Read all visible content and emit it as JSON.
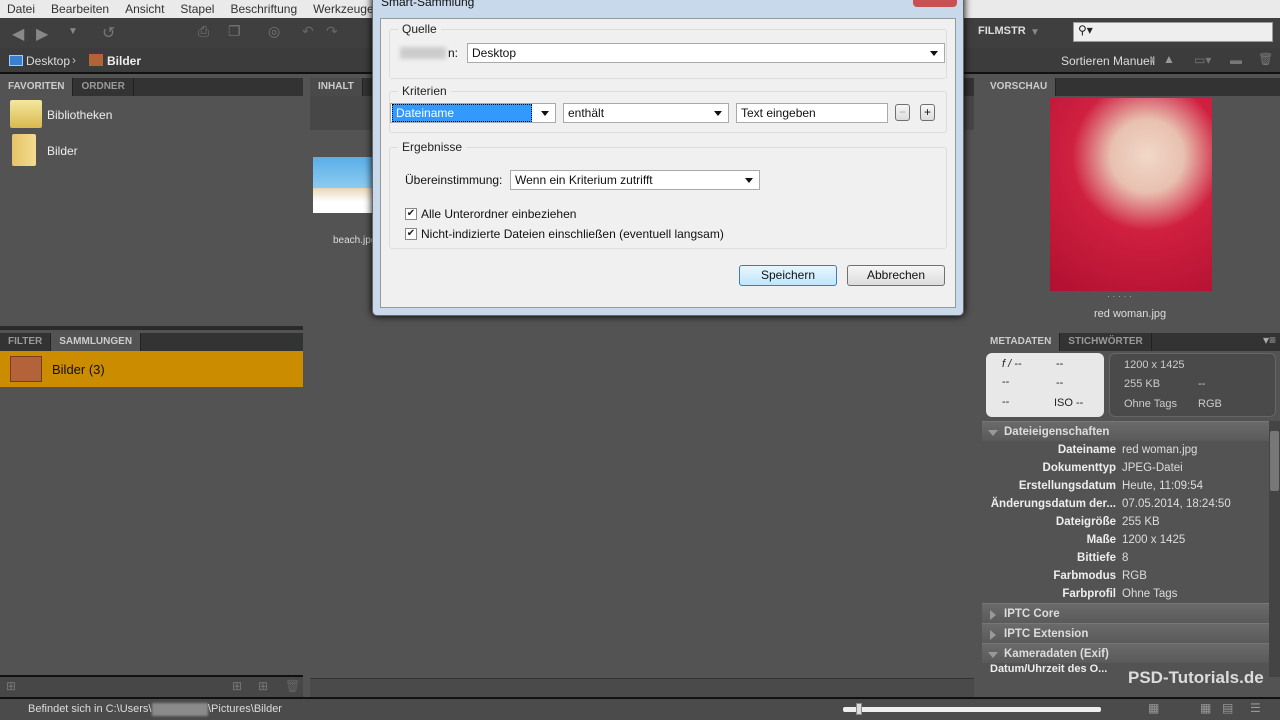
{
  "menu": [
    "Datei",
    "Bearbeiten",
    "Ansicht",
    "Stapel",
    "Beschriftung",
    "Werkzeuge"
  ],
  "breadcrumb": {
    "root": "Desktop",
    "current": "Bilder"
  },
  "workspace": "FILMSTR",
  "search_placeholder": "",
  "sort_label": "Sortieren Manuell",
  "left_tabs": [
    "FAVORITEN",
    "ORDNER"
  ],
  "favorites": [
    {
      "label": "Bibliotheken",
      "icon": "libraries-icon"
    },
    {
      "label": "Bilder",
      "icon": "folder-icon"
    }
  ],
  "lower_tabs": [
    "FILTER",
    "SAMMLUNGEN"
  ],
  "collection": {
    "label": "Bilder (3)",
    "color": "#cc8c00"
  },
  "content_tab": "INHALT",
  "thumb": {
    "label": "beach.jpg"
  },
  "preview_tab": "VORSCHAU",
  "preview_caption": "red woman.jpg",
  "meta_tabs": [
    "METADATEN",
    "STICHWÖRTER"
  ],
  "camera": {
    "aperture": "f / --",
    "shutter": "--",
    "c1": "--",
    "c2": "--",
    "c3": "--",
    "iso": "ISO --"
  },
  "fileinfo": {
    "dims": "1200 x 1425",
    "size": "255 KB",
    "x": "--",
    "tags": "Ohne Tags",
    "mode": "RGB"
  },
  "sections": {
    "file": "Dateieigenschaften",
    "iptc": "IPTC Core",
    "iptcx": "IPTC Extension",
    "exif": "Kameradaten (Exif)",
    "exif_first": "Datum/Uhrzeit des O..."
  },
  "props": [
    {
      "k": "Dateiname",
      "v": "red woman.jpg"
    },
    {
      "k": "Dokumenttyp",
      "v": "JPEG-Datei"
    },
    {
      "k": "Erstellungsdatum",
      "v": "Heute, 11:09:54"
    },
    {
      "k": "Änderungsdatum der...",
      "v": "07.05.2014, 18:24:50"
    },
    {
      "k": "Dateigröße",
      "v": "255 KB"
    },
    {
      "k": "Maße",
      "v": "1200 x 1425"
    },
    {
      "k": "Bittiefe",
      "v": "8"
    },
    {
      "k": "Farbmodus",
      "v": "RGB"
    },
    {
      "k": "Farbprofil",
      "v": "Ohne Tags"
    }
  ],
  "status": {
    "prefix": "Befindet sich in C:\\Users\\",
    "suffix": "\\Pictures\\Bilder",
    "zoom_fraction": 0.05
  },
  "watermark": "PSD-Tutorials.de",
  "dialog": {
    "title": "Smart-Sammlung",
    "source_group": "Quelle",
    "source_label": "n:",
    "source_value": "Desktop",
    "criteria_group": "Kriterien",
    "field": "Dateiname",
    "operator": "enthält",
    "text": "Text eingeben",
    "results_group": "Ergebnisse",
    "match_label": "Übereinstimmung:",
    "match_value": "Wenn ein Kriterium zutrifft",
    "cb1": "Alle Unterordner einbeziehen",
    "cb2": "Nicht-indizierte Dateien einschließen (eventuell langsam)",
    "save": "Speichern",
    "cancel": "Abbrechen"
  }
}
